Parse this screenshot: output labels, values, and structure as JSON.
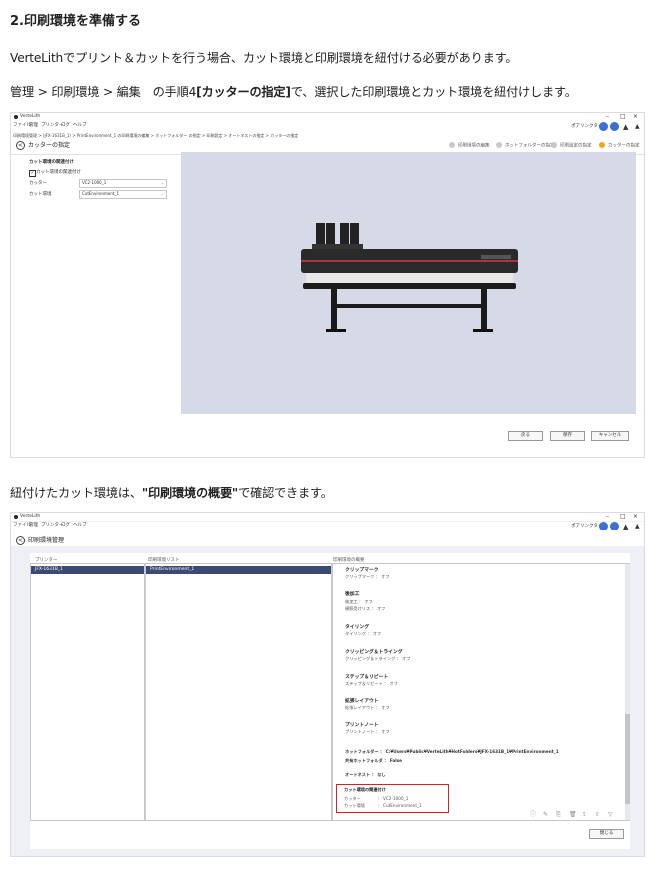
{
  "heading": "2.印刷環境を準備する",
  "para1": "VerteLithでプリント＆カットを行う場合、カット環境と印刷環境を紐付ける必要があります。",
  "para2": {
    "prefix": "管理 > 印刷環境 > 編集　の手順4",
    "bold": "[カッターの指定]",
    "suffix": "で、選択した印刷環境とカット環境を紐付けします。"
  },
  "para3": {
    "prefix": "紐付けたカット環境は、",
    "bold": "\"印刷環境の概要\"",
    "suffix": "で確認できます。"
  },
  "shot1": {
    "app_title": "VerteLith",
    "menu": [
      "ファイル",
      "管理",
      "プリンター",
      "ログ",
      "ヘルプ"
    ],
    "window_controls": [
      "–",
      "□",
      "×"
    ],
    "status_text": "ポアリンクター",
    "breadcrumb": "印刷環境管理 > (JFX-1631B_1) > PrintEnvironment_1 の印刷環境の編集 > ホットフォルダー の指定 > 印刷設定 > オートネストの指定 > カッターの指定",
    "page_title": "カッターの指定",
    "steps": [
      {
        "label": "印刷環境の編集",
        "active": false
      },
      {
        "label": "ホットフォルダーの指定",
        "active": false
      },
      {
        "label": "印刷設定の指定",
        "active": false
      },
      {
        "label": "カッターの指定",
        "active": true
      }
    ],
    "form": {
      "section_title": "カット環境の関連付け",
      "checkbox_label": "カット環境の関連付け",
      "checkbox_checked": true,
      "cutter_label": "カッター",
      "cutter_value": "VC2-1000_1",
      "cut_env_label": "カット環境",
      "cut_env_value": "CutEnvironment_1"
    },
    "buttons": [
      "戻る",
      "保存",
      "キャンセル"
    ]
  },
  "shot2": {
    "app_title": "VerteLith",
    "menu": [
      "ファイル",
      "管理",
      "プリンター",
      "ログ",
      "ヘルプ"
    ],
    "window_controls": [
      "–",
      "□",
      "×"
    ],
    "status_text": "ポアリンクター",
    "page_title": "印刷環境管理",
    "col_printer": "プリンター",
    "col_envlist": "印刷環境リスト",
    "col_overview": "印刷環境の概要",
    "printer_selected": "JFX-1631B_1",
    "env_selected": "PrintEnvironment_1",
    "sections": [
      {
        "title": "クリップマーク",
        "detail": "クリップマーク ： オフ"
      },
      {
        "title": "後加工",
        "detail": "後加工 ： オフ\n横筋受けリス ： オフ"
      },
      {
        "title": "タイリング",
        "detail": "タイリング ： オフ"
      },
      {
        "title": "クリッピング＆トライング",
        "detail": "クリッピング＆トライング ： オフ"
      },
      {
        "title": "ステップ＆リピート",
        "detail": "ステップ＆リピート ： オフ"
      },
      {
        "title": "拡張レイアウト",
        "detail": "拡張レイアウト ： オフ"
      },
      {
        "title": "プリントノート",
        "detail": "プリントノート ： オフ"
      }
    ],
    "hotfolder_line": "ホットフォルダー ： C:¥Users¥Public¥VerteLith¥HotFolders¥JFX-1631B_1¥PrintEnvironment_1",
    "shared_hotfolder": "共有ホットフォルダ ： False",
    "autonest": "オートネスト ： なし",
    "cut_section_title": "カット環境の関連付け",
    "cutter_row": "カッター　　　　： VC2-1000_1",
    "cut_env_row": "カット環境　　　： CutEnvironment_1",
    "close_button": "閉じる"
  }
}
